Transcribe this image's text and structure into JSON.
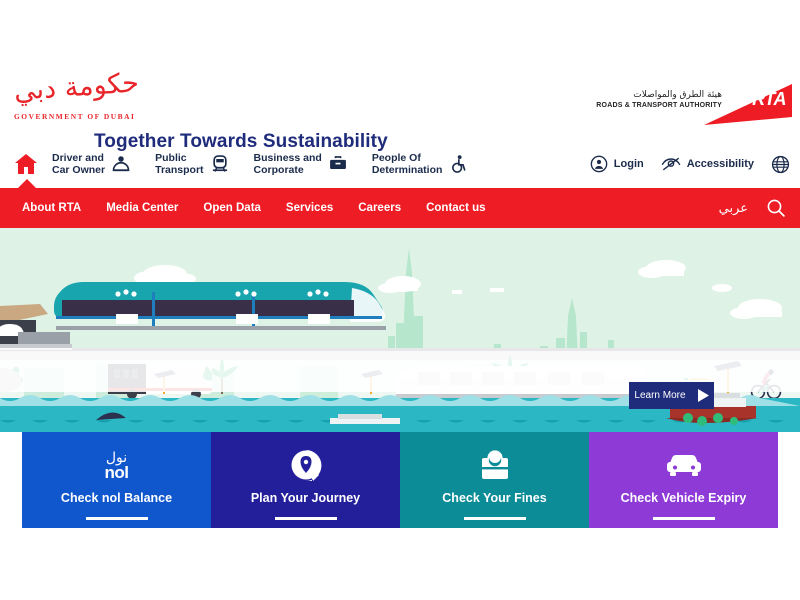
{
  "brand": {
    "gov_logo_arabic": "حكومة دبي",
    "gov_logo_english": "GOVERNMENT OF DUBAI",
    "rta_arabic": "هيئة الطرق والمواصلات",
    "rta_english": "ROADS & TRANSPORT AUTHORITY",
    "rta_mark": "RTA",
    "red": "#ee1c25",
    "navy": "#1f2b7b"
  },
  "main_nav": {
    "home_icon": "home-icon",
    "items": [
      {
        "label": "Driver and\nCar Owner",
        "icon": "driver-icon"
      },
      {
        "label": "Public\nTransport",
        "icon": "train-icon"
      },
      {
        "label": "Business and\nCorporate",
        "icon": "briefcase-icon"
      },
      {
        "label": "People Of\nDetermination",
        "icon": "wheelchair-icon"
      }
    ],
    "right": [
      {
        "label": "Login",
        "icon": "user-circle-icon"
      },
      {
        "label": "Accessibility",
        "icon": "eye-slash-icon"
      }
    ],
    "globe_icon": "globe-icon"
  },
  "red_bar": {
    "items": [
      "About RTA",
      "Media Center",
      "Open Data",
      "Services",
      "Careers",
      "Contact us"
    ],
    "language_toggle": "عربي",
    "search_icon": "search-icon"
  },
  "hero": {
    "title": "Together Towards Sustainability",
    "cta_label": "Learn More",
    "cta_icon": "play-triangle-icon",
    "sky_color": "#dff2e6",
    "water_color": "#2bb8c4"
  },
  "cards": [
    {
      "label": "Check nol Balance",
      "icon": "nol-logo-icon",
      "icon_arabic": "نول",
      "icon_latin": "nol",
      "color": "#1057ce"
    },
    {
      "label": "Plan Your Journey",
      "icon": "map-pin-icon",
      "color": "#231f9b"
    },
    {
      "label": "Check Your Fines",
      "icon": "fines-inbox-icon",
      "color": "#0b8c96"
    },
    {
      "label": "Check Vehicle Expiry",
      "icon": "car-icon",
      "color": "#8e3ad6"
    }
  ]
}
